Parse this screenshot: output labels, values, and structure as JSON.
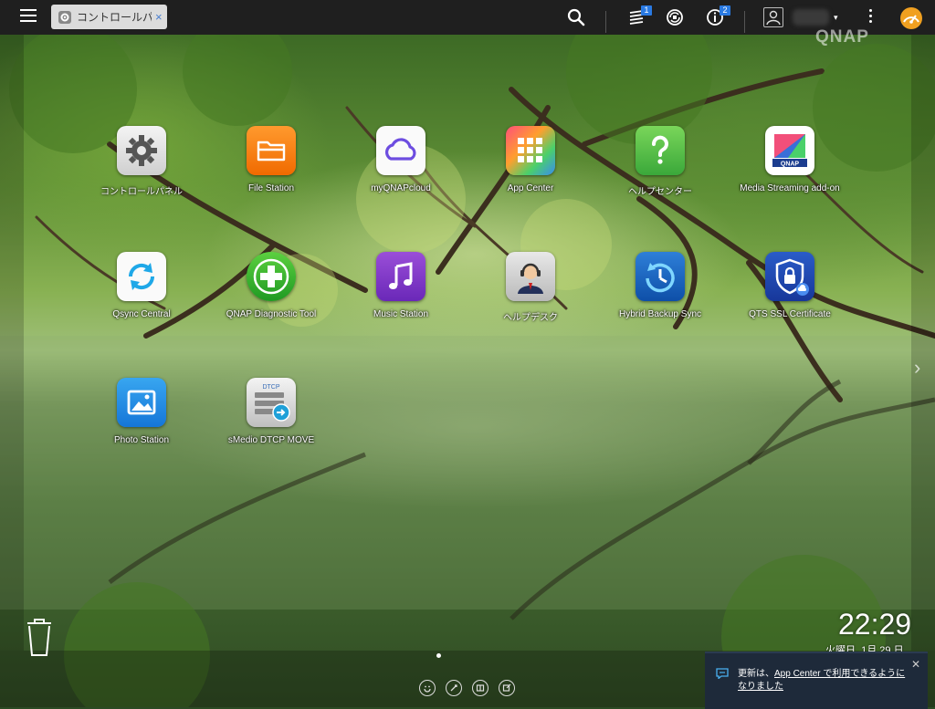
{
  "topbar": {
    "tab_label": "コントロールパ…",
    "tab_icon": "gear-icon",
    "tab_close": "×",
    "task_badge": "1",
    "info_badge": "2",
    "caret": "▾"
  },
  "desktop": {
    "watermark": "QNAP",
    "apps": [
      {
        "label": "コントロールパネル",
        "icon": "control-panel-gear-icon"
      },
      {
        "label": "File Station",
        "icon": "folder-icon"
      },
      {
        "label": "myQNAPcloud",
        "icon": "cloud-icon"
      },
      {
        "label": "App Center",
        "icon": "app-grid-icon"
      },
      {
        "label": "ヘルプセンター",
        "icon": "question-mark-icon"
      },
      {
        "label": "Media Streaming add-on",
        "icon": "qnap-media-icon"
      },
      {
        "label": "Qsync Central",
        "icon": "sync-arrows-icon"
      },
      {
        "label": "QNAP Diagnostic Tool",
        "icon": "plus-cross-icon"
      },
      {
        "label": "Music Station",
        "icon": "music-note-icon"
      },
      {
        "label": "ヘルプデスク",
        "icon": "headset-person-icon"
      },
      {
        "label": "Hybrid Backup Sync",
        "icon": "backup-clock-icon"
      },
      {
        "label": "QTS SSL Certificate",
        "icon": "shield-lock-icon"
      },
      {
        "label": "Photo Station",
        "icon": "photo-icon"
      },
      {
        "label": "sMedio DTCP MOVE",
        "icon": "dtcp-move-icon"
      }
    ],
    "dtcp_text": "DTCP",
    "qnap_badge_text": "QNAP"
  },
  "clock": {
    "time": "22:29",
    "date": "火曜日, 1月 29 日"
  },
  "toast": {
    "message_prefix": "更新は、",
    "message_link": "App Center で利用できるように",
    "message_suffix": "なりました",
    "close": "✕"
  },
  "colors": {
    "topbar_bg": "#1f1f1f",
    "tab_bg": "#dcdcdc",
    "badge_blue": "#2a7ae2",
    "toast_bg": "#1e2a3a"
  }
}
